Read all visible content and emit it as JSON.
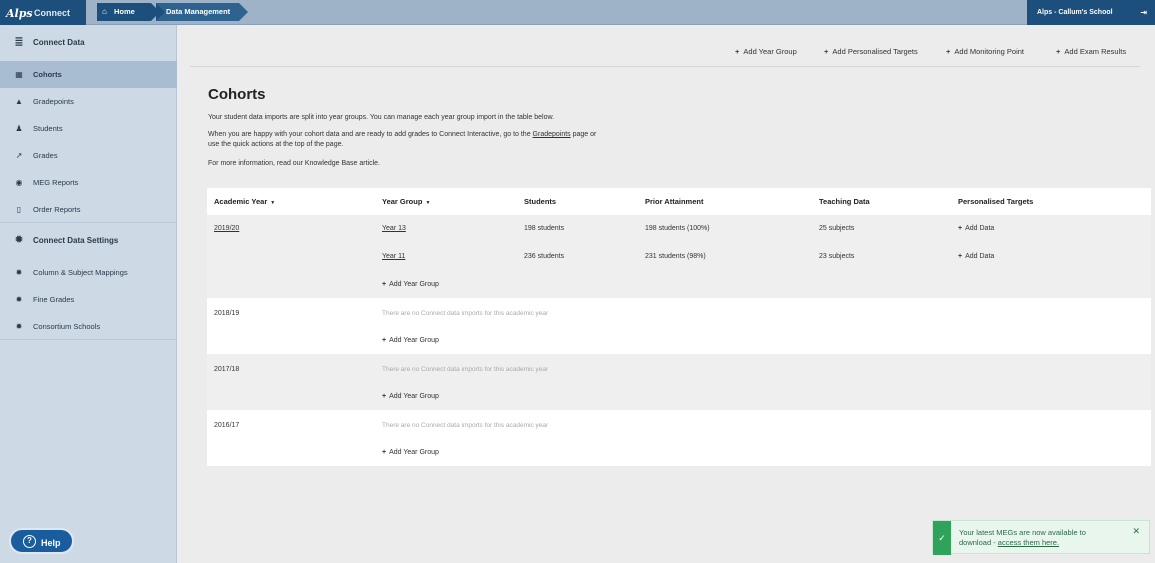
{
  "topbar": {
    "logo_alps": "Alps",
    "logo_connect": "Connect",
    "breadcrumbs": [
      "Home",
      "Data Management"
    ],
    "school": "Alps - Callum's School"
  },
  "sidebar": {
    "items": [
      {
        "label": "Connect Data",
        "icon": "database-icon"
      },
      {
        "label": "Cohorts",
        "icon": "table-icon"
      },
      {
        "label": "Gradepoints",
        "icon": "graduation-cap-icon"
      },
      {
        "label": "Students",
        "icon": "person-icon"
      },
      {
        "label": "Grades",
        "icon": "line-chart-icon"
      },
      {
        "label": "MEG Reports",
        "icon": "target-icon"
      },
      {
        "label": "Order Reports",
        "icon": "document-icon"
      },
      {
        "label": "Connect Data Settings",
        "icon": "gear-icon"
      },
      {
        "label": "Column & Subject Mappings",
        "icon": "gear-icon"
      },
      {
        "label": "Fine Grades",
        "icon": "gear-icon"
      },
      {
        "label": "Consortium Schools",
        "icon": "gear-icon"
      }
    ],
    "help": "Help"
  },
  "quick_actions": [
    "Add Year Group",
    "Add Personalised Targets",
    "Add Monitoring Point",
    "Add Exam Results"
  ],
  "page": {
    "title": "Cohorts",
    "intro1": "Your student data imports are split into year groups. You can manage each year group import in the table below.",
    "intro2a": "When you are happy with your cohort data and are ready to add grades to Connect Interactive, go to the ",
    "intro2_link": "Gradepoints",
    "intro2b": " page or",
    "intro2c": "use the quick actions at the top of the page.",
    "intro3": "For more information, read our Knowledge Base article."
  },
  "table": {
    "headers": [
      "Academic Year",
      "Year Group",
      "Students",
      "Prior Attainment",
      "Teaching Data",
      "Personalised Targets"
    ],
    "add_year_group": "Add Year Group",
    "add_data": "Add Data",
    "no_imports": "There are no Connect data imports for this academic year",
    "years": [
      {
        "year": "2019/20",
        "rows": [
          {
            "group": "Year 13",
            "students": "198 students",
            "prior": "198 students (100%)",
            "teaching": "25 subjects"
          },
          {
            "group": "Year 11",
            "students": "236 students",
            "prior": "231 students (98%)",
            "teaching": "23 subjects"
          }
        ]
      },
      {
        "year": "2018/19"
      },
      {
        "year": "2017/18"
      },
      {
        "year": "2016/17"
      }
    ]
  },
  "toast": {
    "line1": "Your latest MEGs are now available to",
    "line2a": "download - ",
    "line2_link": "access them here."
  }
}
